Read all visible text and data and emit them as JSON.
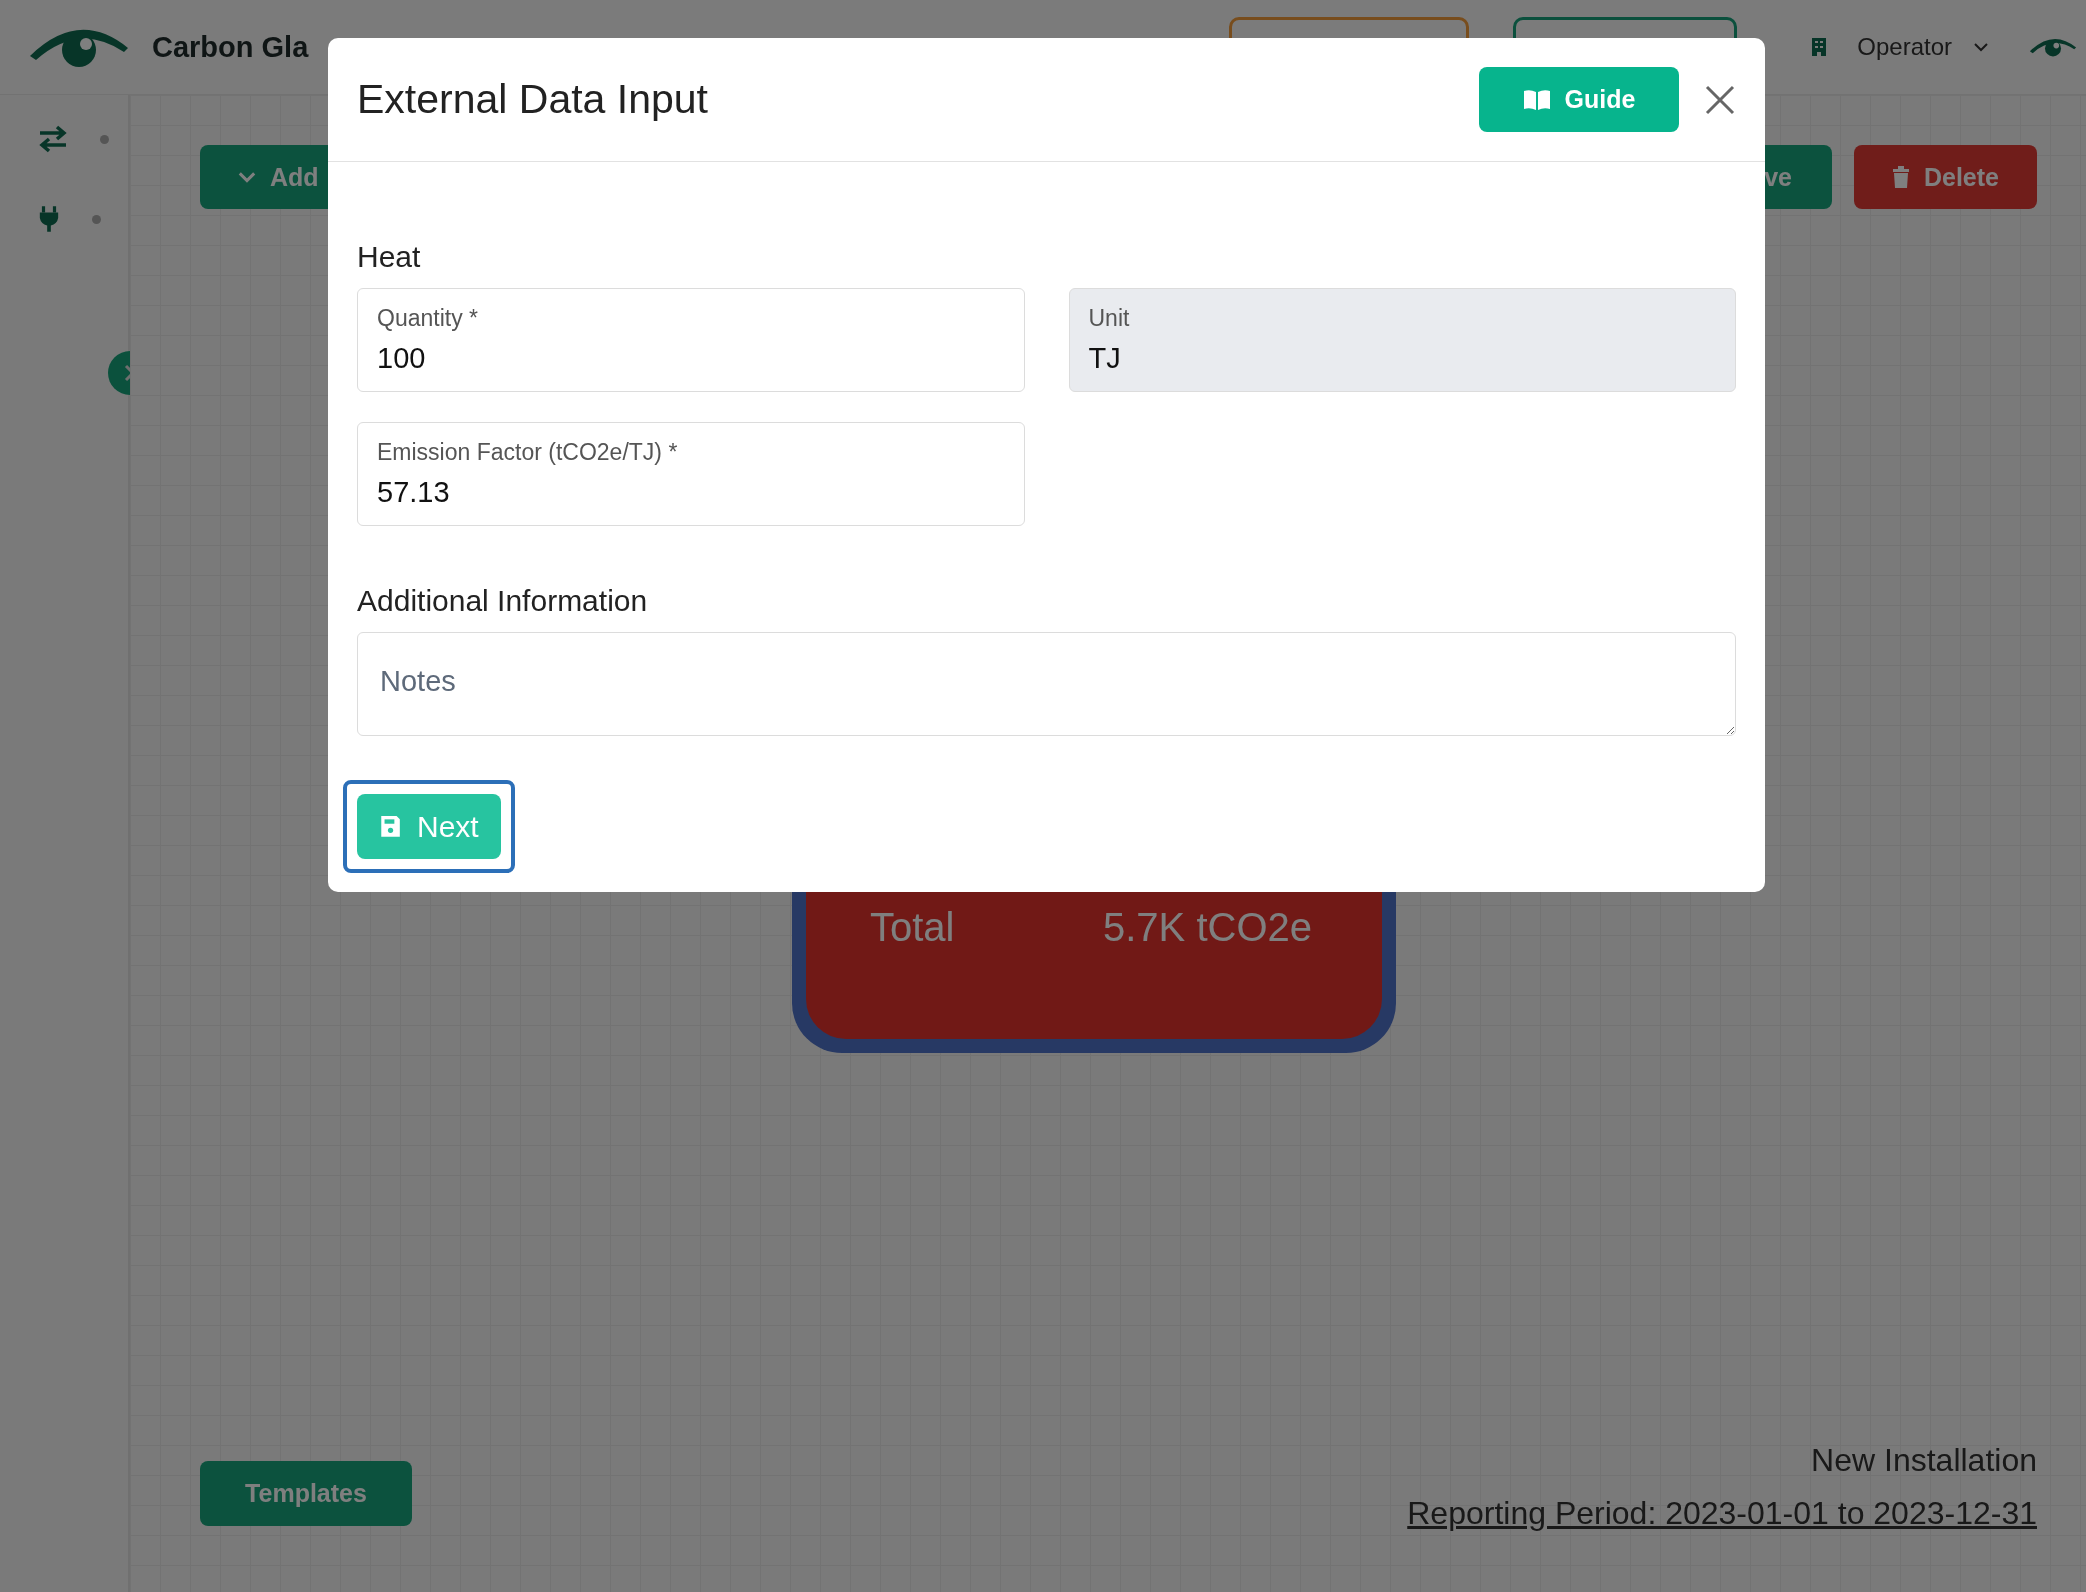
{
  "header": {
    "brand": "Carbon Gla",
    "user": "Operator"
  },
  "toolbar": {
    "buttons": [
      {
        "label": "Add",
        "kind": "add"
      },
      {
        "label": "ve",
        "kind": "save"
      },
      {
        "label": "Delete",
        "kind": "delete"
      }
    ]
  },
  "node": {
    "label": "Total",
    "value": "5.7K tCO2e"
  },
  "templates_button": "Templates",
  "footer": {
    "installation": "New Installation",
    "period": "Reporting Period: 2023-01-01 to 2023-12-31"
  },
  "modal": {
    "title": "External Data Input",
    "guide_button": "Guide",
    "sections": [
      {
        "title": "Heat",
        "fields": [
          {
            "label": "Quantity *",
            "value": "100",
            "disabled": false
          },
          {
            "label": "Unit",
            "value": "TJ",
            "disabled": true
          },
          {
            "label": "Emission Factor (tCO2e/TJ) *",
            "value": "57.13",
            "disabled": false
          }
        ]
      },
      {
        "title": "Additional Information",
        "notes": {
          "placeholder": "Notes"
        }
      }
    ],
    "next_button": {
      "label": "Next",
      "focused": true
    }
  }
}
